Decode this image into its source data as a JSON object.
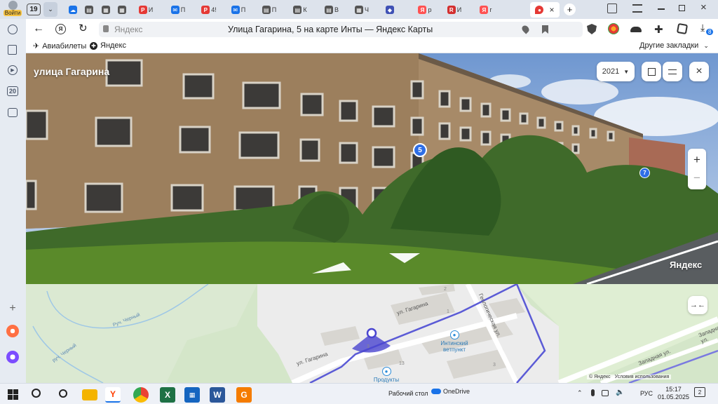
{
  "tabstrip": {
    "profile_label": "Войти",
    "tab_counter": "19",
    "tabs": [
      {
        "icon": "cloud-icon",
        "label": "",
        "color": "#1a73e8"
      },
      {
        "icon": "doc-icon",
        "label": "",
        "color": "#555555"
      },
      {
        "icon": "sheet-icon",
        "label": "",
        "color": "#555555"
      },
      {
        "icon": "sheet-icon",
        "label": "",
        "color": "#555555"
      },
      {
        "icon": "pdf-icon",
        "label": "И",
        "color": "#e53935"
      },
      {
        "icon": "mail-icon",
        "label": "П",
        "color": "#1a73e8"
      },
      {
        "icon": "pdf-icon",
        "label": "4!",
        "color": "#e53935"
      },
      {
        "icon": "mail-icon",
        "label": "П",
        "color": "#1a73e8"
      },
      {
        "icon": "doc-icon",
        "label": "П",
        "color": "#555555"
      },
      {
        "icon": "doc-icon",
        "label": "К",
        "color": "#555555"
      },
      {
        "icon": "doc-icon",
        "label": "В",
        "color": "#555555"
      },
      {
        "icon": "sheet-icon",
        "label": "Ч",
        "color": "#555555"
      },
      {
        "icon": "shield-icon",
        "label": "",
        "color": "#3f51b5"
      },
      {
        "icon": "yandex-icon",
        "label": "р",
        "color": "#ff5252"
      },
      {
        "icon": "rtc-icon",
        "label": "И",
        "color": "#d32f2f"
      },
      {
        "icon": "yandex-icon",
        "label": "г",
        "color": "#ff5252"
      }
    ],
    "active_tab_icon": "map-pin-icon"
  },
  "addressbar": {
    "domain": "Яндекс",
    "page_title": "Улица Гагарина, 5 на карте Инты — Яндекс Карты",
    "downloads_badge": "8"
  },
  "bookmarks": {
    "items": [
      {
        "icon": "plane-icon",
        "label": "Авиабилеты"
      },
      {
        "icon": "yandex-circle-icon",
        "label": "Яндекс"
      }
    ],
    "other_label": "Другие закладки"
  },
  "sidebar": {
    "badge": "20"
  },
  "panorama": {
    "street_label": "улица Гагарина",
    "year": "2021",
    "house_markers": [
      "5",
      "7"
    ],
    "watermark": "Яндекс",
    "zoom_in": "+",
    "zoom_out": "−"
  },
  "map": {
    "streets": [
      "ул. Гагарина",
      "ул. Гагарина",
      "Геологическая ул.",
      "Западная ул.",
      "Западная ул."
    ],
    "water": [
      "Руч. Черный",
      "руч. Черный"
    ],
    "poi": [
      {
        "icon": "paw-icon",
        "name": "Интинский ветпункт"
      },
      {
        "icon": "cart-icon",
        "name": "Продукты"
      }
    ],
    "house_numbers": [
      "2",
      "1",
      "3",
      "13",
      "3"
    ],
    "copyright": "© Яндекс",
    "terms": "Условия использования"
  },
  "taskbar": {
    "desktop_label": "Рабочий стол",
    "onedrive_label": "OneDrive",
    "lang": "РУС",
    "time": "15:17",
    "date": "01.05.2025",
    "notif_count": "2",
    "apps": [
      {
        "icon": "windows-icon",
        "color": "#1a73e8"
      },
      {
        "icon": "search-icon",
        "color": "#333333"
      },
      {
        "icon": "taskview-icon",
        "color": "#333333"
      },
      {
        "icon": "folder-icon",
        "color": "#f4b400"
      },
      {
        "icon": "yandex-browser-icon",
        "color": "#ff3d00"
      },
      {
        "icon": "chrome-icon",
        "color": "#34a853"
      },
      {
        "icon": "excel-icon",
        "color": "#1e7145"
      },
      {
        "icon": "calculator-icon",
        "color": "#1565c0"
      },
      {
        "icon": "word-icon",
        "color": "#2b579a"
      },
      {
        "icon": "app-icon",
        "color": "#f57c00"
      }
    ]
  }
}
